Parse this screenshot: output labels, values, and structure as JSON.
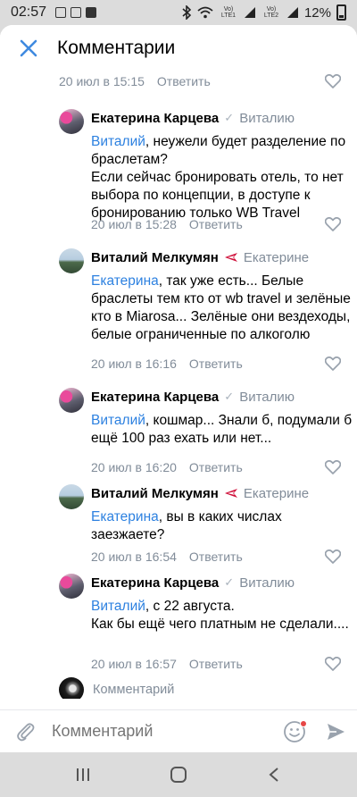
{
  "status_bar": {
    "time": "02:57",
    "network_1": "Vo) LTE1",
    "network_2": "Vo) LTE2",
    "battery": "12%"
  },
  "header": {
    "title": "Комментарии",
    "close_icon": "close-icon"
  },
  "top_meta": {
    "date": "20 июл в 15:15",
    "reply": "Ответить"
  },
  "comments": [
    {
      "author": "Екатерина Карцева",
      "reply_to": "Виталию",
      "mention": "Виталий",
      "text": ", неужели будет разделение по браслетам?\nЕсли сейчас бронировать отель, то нет выбора по концепции, в доступе к бронированию только WB Travel",
      "date": "20 июл в 15:28",
      "reply": "Ответить"
    },
    {
      "author": "Виталий Мелкумян",
      "reply_to": "Екатерине",
      "mention": "Екатерина",
      "text": ", так уже есть... Белые браслеты тем кто от wb travel и зелёные кто в Miarosa... Зелёные они вездеходы, белые ограниченные по алкоголю",
      "date": "20 июл в 16:16",
      "reply": "Ответить"
    },
    {
      "author": "Екатерина Карцева",
      "reply_to": "Виталию",
      "mention": "Виталий",
      "text": ", кошмар... Знали б, подумали б ещё 100 раз ехать или нет...",
      "date": "20 июл в 16:20",
      "reply": "Ответить"
    },
    {
      "author": "Виталий Мелкумян",
      "reply_to": "Екатерине",
      "mention": "Екатерина",
      "text": ", вы в каких числах заезжаете?",
      "date": "20 июл в 16:54",
      "reply": "Ответить"
    },
    {
      "author": "Екатерина Карцева",
      "reply_to": "Виталию",
      "mention": "Виталий",
      "text": ", с 22 августа.\nКак бы ещё чего платным не сделали....",
      "date": "20 июл в 16:57",
      "reply": "Ответить"
    }
  ],
  "composer_hint": "Комментарий",
  "input": {
    "placeholder": "Комментарий"
  },
  "colors": {
    "mention": "#2d81e0",
    "accent": "#3f8ae0",
    "meta": "#818c99",
    "notification_dot": "#e64646"
  }
}
